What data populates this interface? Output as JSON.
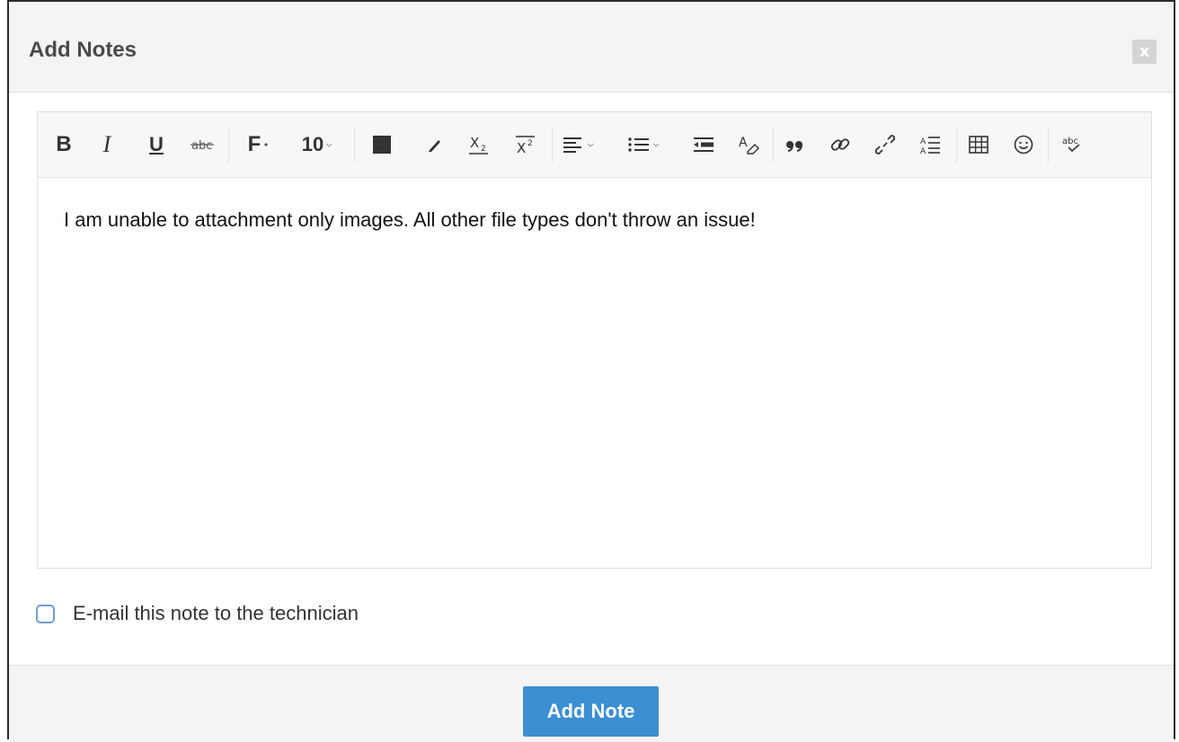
{
  "dialog": {
    "title": "Add Notes",
    "close_label": "x"
  },
  "toolbar": {
    "bold": "B",
    "italic": "I",
    "underline": "U",
    "font_family": "F",
    "font_size": "10"
  },
  "editor": {
    "content": "I am unable to attachment only images. All other file types don't throw an issue!"
  },
  "options": {
    "email_label": "E-mail this note to the technician",
    "email_checked": false
  },
  "footer": {
    "submit_label": "Add Note"
  },
  "colors": {
    "accent": "#3b8fd3",
    "checkbox_border": "#6d9fd6"
  }
}
